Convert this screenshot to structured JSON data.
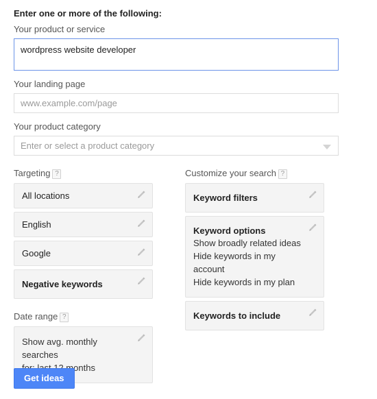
{
  "form": {
    "heading": "Enter one or more of the following:",
    "product_service": {
      "label": "Your product or service",
      "value": "wordpress website developer"
    },
    "landing_page": {
      "label": "Your landing page",
      "placeholder": "www.example.com/page",
      "value": ""
    },
    "product_category": {
      "label": "Your product category",
      "placeholder": "Enter or select a product category",
      "value": "",
      "caret_icon": "chevron-down-icon"
    }
  },
  "targeting": {
    "label": "Targeting",
    "help": "?",
    "cards": [
      {
        "title": "All locations",
        "bold": false,
        "edit_icon": "pencil-icon"
      },
      {
        "title": "English",
        "bold": false,
        "edit_icon": "pencil-icon"
      },
      {
        "title": "Google",
        "bold": false,
        "edit_icon": "pencil-icon"
      },
      {
        "title": "Negative keywords",
        "bold": true,
        "edit_icon": "pencil-icon"
      }
    ]
  },
  "date_range": {
    "label": "Date range",
    "help": "?",
    "card": {
      "line1": "Show avg. monthly searches",
      "line2": "for: last 12 months",
      "edit_icon": "pencil-icon"
    }
  },
  "customize": {
    "label": "Customize your search",
    "help": "?",
    "keyword_filters": {
      "title": "Keyword filters",
      "edit_icon": "pencil-icon"
    },
    "keyword_options": {
      "title": "Keyword options",
      "lines": [
        "Show broadly related ideas",
        "Hide keywords in my account",
        "Hide keywords in my plan"
      ],
      "edit_icon": "pencil-icon"
    },
    "keywords_to_include": {
      "title": "Keywords to include",
      "edit_icon": "pencil-icon"
    }
  },
  "actions": {
    "get_ideas_label": "Get ideas"
  },
  "colors": {
    "accent_blue": "#4d86f7",
    "focus_border": "#6b93e8",
    "card_bg": "#f4f4f4",
    "card_border": "#e2e2e2"
  }
}
